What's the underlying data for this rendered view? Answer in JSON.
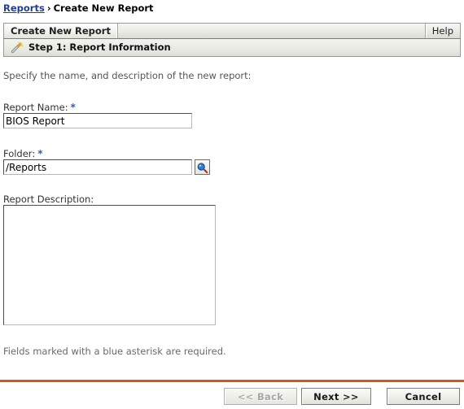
{
  "breadcrumb": {
    "link_label": "Reports",
    "separator": "›",
    "current_label": "Create New Report"
  },
  "tabs": {
    "active_label": "Create New Report",
    "help_label": "Help"
  },
  "step_header": {
    "icon": "wand-icon",
    "title": "Step 1: Report Information"
  },
  "form": {
    "intro": "Specify the name, and description of the new report:",
    "required_marker": "*",
    "report_name": {
      "label": "Report Name:",
      "value": "BIOS Report",
      "placeholder": ""
    },
    "folder": {
      "label": "Folder:",
      "value": "/Reports",
      "placeholder": "",
      "browse_icon": "search-icon"
    },
    "report_description": {
      "label": "Report Description:",
      "value": "",
      "placeholder": ""
    },
    "required_note": "Fields marked with a blue asterisk are required."
  },
  "footer": {
    "back_label": "<< Back",
    "next_label": "Next >>",
    "cancel_label": "Cancel"
  },
  "colors": {
    "accent_rule": "#d4541c",
    "required_asterisk": "#2b5fbf",
    "breadcrumb_link": "#1f3f8c"
  }
}
